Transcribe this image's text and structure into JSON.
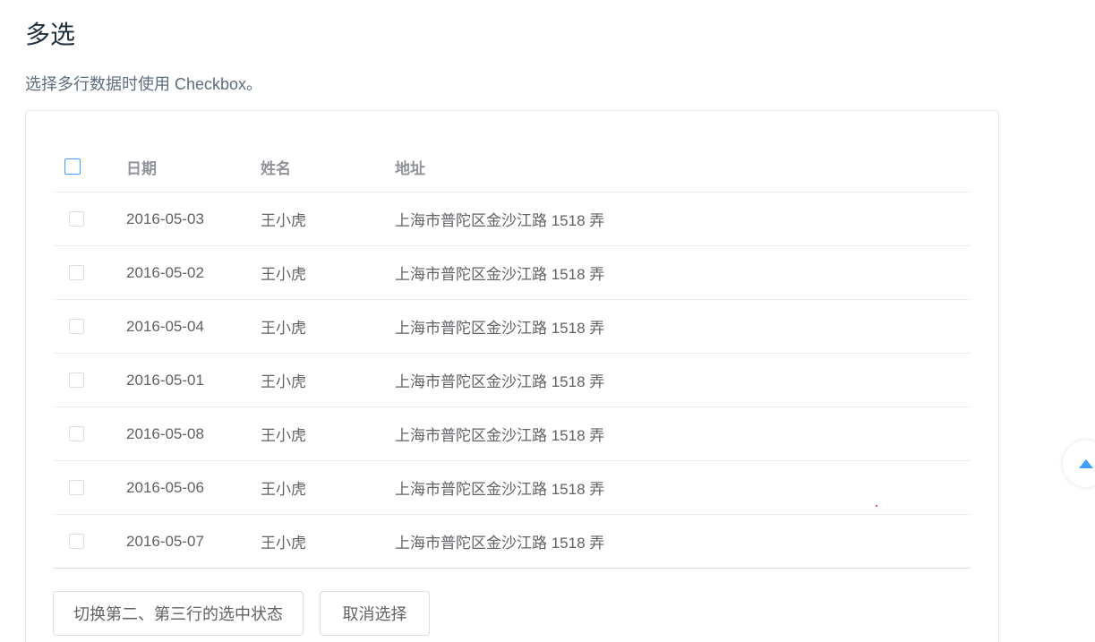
{
  "page": {
    "title": "多选",
    "description": "选择多行数据时使用 Checkbox。"
  },
  "table": {
    "headers": {
      "date": "日期",
      "name": "姓名",
      "address": "地址"
    },
    "rows": [
      {
        "date": "2016-05-03",
        "name": "王小虎",
        "address": "上海市普陀区金沙江路 1518 弄"
      },
      {
        "date": "2016-05-02",
        "name": "王小虎",
        "address": "上海市普陀区金沙江路 1518 弄"
      },
      {
        "date": "2016-05-04",
        "name": "王小虎",
        "address": "上海市普陀区金沙江路 1518 弄"
      },
      {
        "date": "2016-05-01",
        "name": "王小虎",
        "address": "上海市普陀区金沙江路 1518 弄"
      },
      {
        "date": "2016-05-08",
        "name": "王小虎",
        "address": "上海市普陀区金沙江路 1518 弄"
      },
      {
        "date": "2016-05-06",
        "name": "王小虎",
        "address": "上海市普陀区金沙江路 1518 弄"
      },
      {
        "date": "2016-05-07",
        "name": "王小虎",
        "address": "上海市普陀区金沙江路 1518 弄"
      }
    ]
  },
  "buttons": {
    "toggle": "切换第二、第三行的选中状态",
    "clear": "取消选择"
  },
  "colors": {
    "accent": "#409eff",
    "title": "#1f2f3d",
    "text": "#606266",
    "header_text": "#909399",
    "border": "#ebeef5"
  },
  "icons": {
    "back_to_top": "caret-up-icon"
  }
}
